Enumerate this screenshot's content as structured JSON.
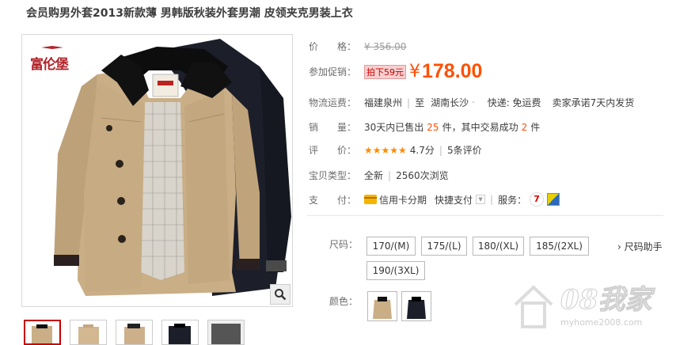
{
  "title": "会员购男外套2013新款薄 男韩版秋装外套男潮 皮领夹克男装上衣",
  "gallery": {
    "brand_logo": "富伦堡",
    "zoom_icon": "magnifier-icon"
  },
  "price": {
    "label": "价　　格：",
    "original": "¥ 356.00"
  },
  "promo": {
    "label": "参加促销：",
    "badge": "拍下59元",
    "yen": "¥",
    "price": "178.00"
  },
  "shipping": {
    "label": "物流运费：",
    "from": "福建泉州",
    "to_prefix": "至",
    "to": "湖南长沙",
    "express": "快递: 免运费",
    "promise": "卖家承诺7天内发货"
  },
  "sales": {
    "label": "销　　量：",
    "prefix": "30天内已售出",
    "sold": "25",
    "mid": "件，其中交易成功",
    "success": "2",
    "suffix": "件"
  },
  "rating": {
    "label": "评　　价：",
    "stars": "★★★★★",
    "score": "4.7分",
    "reviews": "5条评价"
  },
  "condition": {
    "label": "宝贝类型：",
    "type": "全新",
    "views": "2560次浏览"
  },
  "payment": {
    "label": "支　　付：",
    "credit": "信用卡分期",
    "quick": "快捷支付",
    "services_label": "服务："
  },
  "size": {
    "label": "尺码：",
    "options": [
      "170/(M)",
      "175/(L)",
      "180/(XL)",
      "185/(2XL)",
      "190/(3XL)"
    ],
    "helper": "尺码助手"
  },
  "color": {
    "label": "颜色："
  },
  "watermark": {
    "text": "08我家",
    "url": "myhome2008.com"
  }
}
